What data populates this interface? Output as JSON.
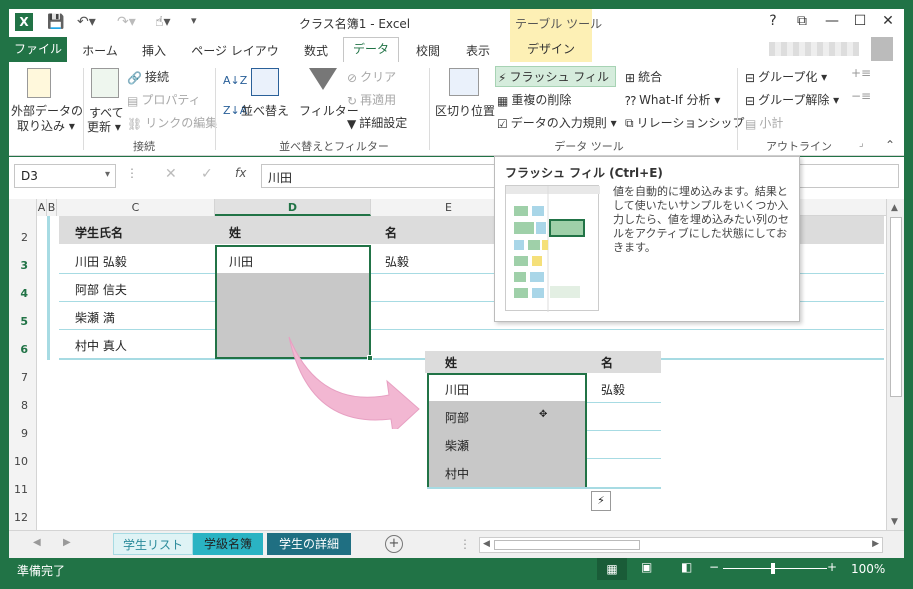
{
  "app": {
    "title": "クラス名簿1 - Excel",
    "contextual_group": "テーブル ツール",
    "help": "?"
  },
  "tabs": [
    "ファイル",
    "ホーム",
    "挿入",
    "ページ レイアウト",
    "数式",
    "データ",
    "校閲",
    "表示",
    "デザイン"
  ],
  "ribbon": {
    "external": "外部データの\n取り込み",
    "ext1": "外部データの",
    "ext2": "取り込み ▾",
    "refresh1": "すべて",
    "refresh2": "更新 ▾",
    "connections": "接続",
    "properties": "プロパティ",
    "edit_links": "リンクの編集",
    "group_connections": "接続",
    "sort": "並べ替え",
    "filter": "フィルター",
    "clear": "クリア",
    "reapply": "再適用",
    "advanced": "詳細設定",
    "group_sortfilter": "並べ替えとフィルター",
    "text_to_columns": "区切り位置",
    "flash_fill": "フラッシュ フィル",
    "remove_dup": "重複の削除",
    "validation": "データの入力規則 ▾",
    "consolidate": "統合",
    "whatif": "What-If 分析 ▾",
    "relationships": "リレーションシップ",
    "group_datatools": "データ ツール",
    "group": "グループ化 ▾",
    "ungroup": "グループ解除 ▾",
    "subtotal": "小計",
    "group_outline": "アウトライン"
  },
  "formula": {
    "namebox": "D3",
    "fx": "fx",
    "value": "川田"
  },
  "tooltip": {
    "title": "フラッシュ フィル (Ctrl+E)",
    "body": "値を自動的に埋め込みます。結果として使いたいサンプルをいくつか入力したら、値を埋め込みたい列のセルをアクティブにした状態にしておきます。"
  },
  "grid": {
    "columns": [
      "A",
      "B",
      "C",
      "D",
      "E"
    ],
    "rows": [
      "2",
      "3",
      "4",
      "5",
      "6",
      "7",
      "8",
      "9",
      "10",
      "11",
      "12"
    ],
    "header": {
      "c": "学生氏名",
      "d": "姓",
      "e": "名"
    },
    "names": [
      "川田 弘毅",
      "阿部 信夫",
      "柴瀬 満",
      "村中 真人"
    ],
    "d3": "川田",
    "e3": "弘毅"
  },
  "example": {
    "h1": "姓",
    "h2": "名",
    "rows": [
      "川田",
      "阿部",
      "柴瀬",
      "村中"
    ],
    "first_given": "弘毅"
  },
  "sheets": [
    "学生リスト",
    "学級名簿",
    "学生の詳細"
  ],
  "status": {
    "ready": "準備完了",
    "zoom": "100%"
  }
}
